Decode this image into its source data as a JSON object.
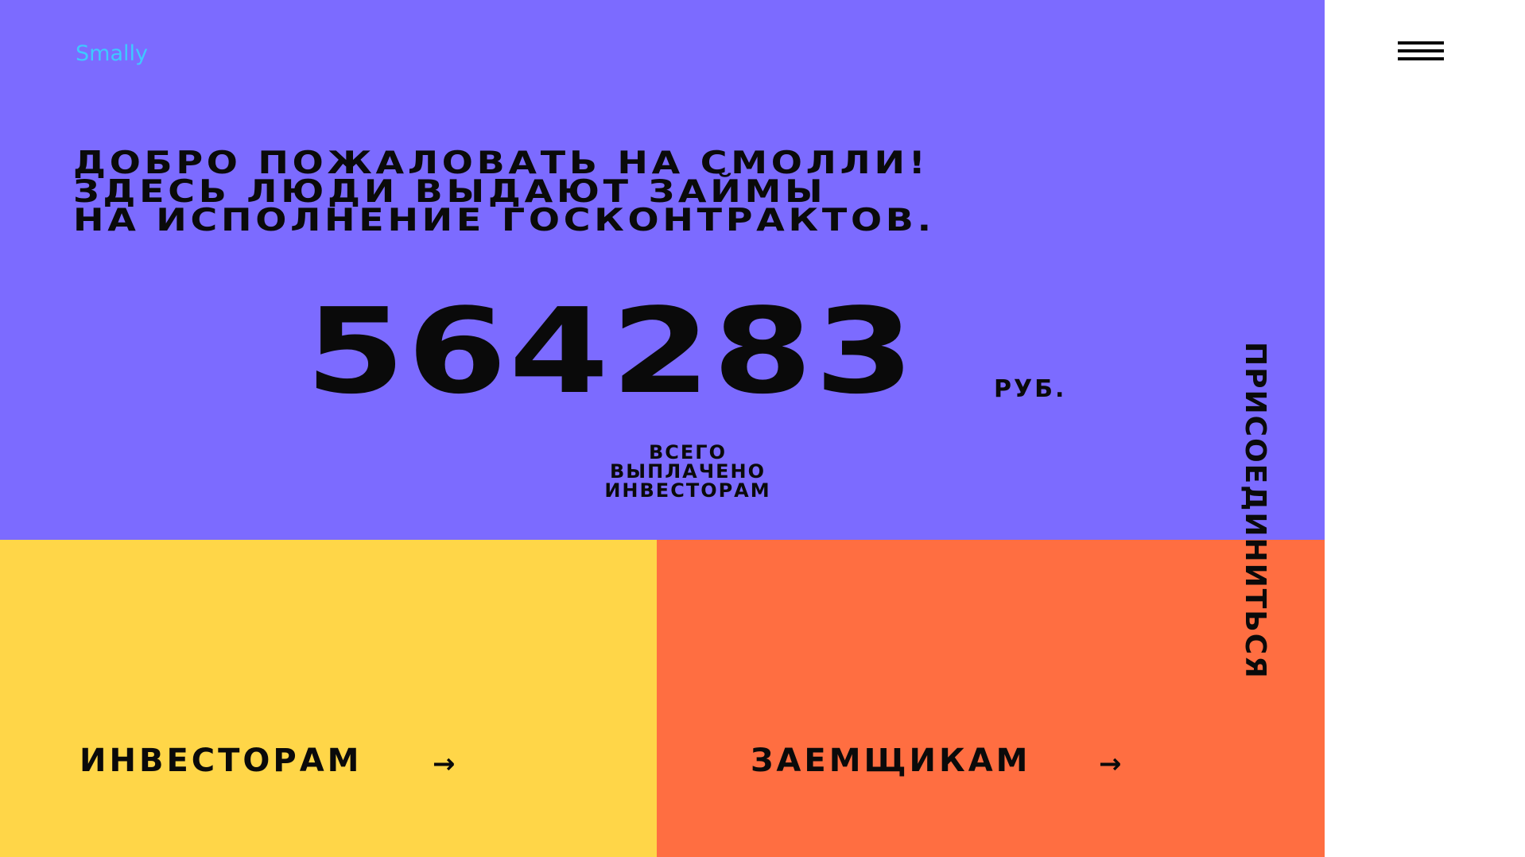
{
  "brand": {
    "logo_text": "Smally"
  },
  "hero": {
    "welcome_lines": [
      "ДОБРО ПОЖАЛОВАТЬ НА СМОЛЛИ!",
      "ЗДЕСЬ ЛЮДИ ВЫДАЮТ ЗАЙМЫ",
      "НА ИСПОЛНЕНИЕ ГОСКОНТРАКТОВ."
    ],
    "counter_value": "564283",
    "counter_unit": "РУБ.",
    "caption_lines": [
      "ВСЕГО",
      "ВЫПЛАЧЕНО",
      "ИНВЕСТОРАМ"
    ]
  },
  "cards": {
    "investors": {
      "label": "ИНВЕСТОРАМ",
      "arrow": "→"
    },
    "borrowers": {
      "label": "ЗАЕМЩИКАМ",
      "arrow": "→"
    }
  },
  "sidebar": {
    "menu_icon": "hamburger-menu-icon",
    "join_label": "ПРИСОЕДИНИТЬСЯ"
  },
  "colors": {
    "hero_bg": "#7c6bff",
    "investors_bg": "#ffd648",
    "borrowers_bg": "#ff6e41",
    "logo": "#3ec9ff",
    "text": "#0a0a0a"
  }
}
